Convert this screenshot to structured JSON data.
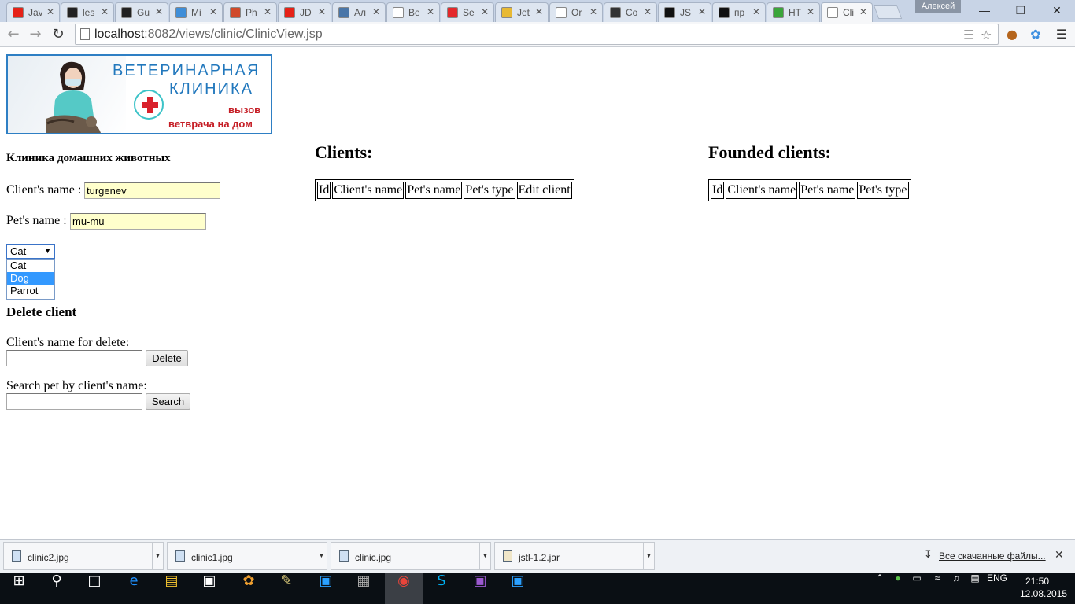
{
  "browser": {
    "tabs": [
      {
        "label": "Jav",
        "favicon_color": "#e62117"
      },
      {
        "label": "les",
        "favicon_color": "#222222"
      },
      {
        "label": "Gu",
        "favicon_color": "#222222"
      },
      {
        "label": "Mi",
        "favicon_color": "#3f8ed8"
      },
      {
        "label": "Ph",
        "favicon_color": "#d04a2a"
      },
      {
        "label": "JD",
        "favicon_color": "#e62117"
      },
      {
        "label": "Ал",
        "favicon_color": "#4a76a8"
      },
      {
        "label": "Be",
        "favicon_color": "#ffffff"
      },
      {
        "label": "Se",
        "favicon_color": "#e4282b"
      },
      {
        "label": "Jet",
        "favicon_color": "#e8b933"
      },
      {
        "label": "Or",
        "favicon_color": "#ffffff"
      },
      {
        "label": "Co",
        "favicon_color": "#333333"
      },
      {
        "label": "JS",
        "favicon_color": "#111111"
      },
      {
        "label": "пр",
        "favicon_color": "#111111"
      },
      {
        "label": "НТ",
        "favicon_color": "#3aa53a"
      },
      {
        "label": "Cli",
        "favicon_color": "#ffffff"
      }
    ],
    "user_name": "Алексей",
    "url_host": "localhost",
    "url_rest": ":8082/views/clinic/ClinicView.jsp"
  },
  "page": {
    "banner": {
      "line1": "ВЕТЕРИНАРНАЯ",
      "line2": "КЛИНИКА",
      "line3": "вызов",
      "line4": "ветврача на дом"
    },
    "clinic_title": "Клиника домашних животных",
    "client_name_label": "Client's name :",
    "client_name_value": "turgenev",
    "pet_name_label": "Pet's name :",
    "pet_name_value": "mu-mu",
    "pet_type_selected": "Cat",
    "pet_type_options": [
      "Cat",
      "Dog",
      "Parrot"
    ],
    "pet_type_highlighted": "Dog",
    "delete_title": "Delete client",
    "delete_label": "Client's name for delete:",
    "delete_button": "Delete",
    "search_label": "Search pet by client's name:",
    "search_button": "Search",
    "clients_title": "Clients:",
    "clients_headers": [
      "Id",
      "Client's name",
      "Pet's name",
      "Pet's type",
      "Edit client"
    ],
    "founded_title": "Founded clients:",
    "founded_headers": [
      "Id",
      "Client's name",
      "Pet's name",
      "Pet's type"
    ]
  },
  "downloads": {
    "items": [
      "clinic2.jpg",
      "clinic1.jpg",
      "clinic.jpg",
      "jstl-1.2.jar"
    ],
    "show_all": "Все скачанные файлы..."
  },
  "taskbar": {
    "language": "ENG",
    "time": "21:50",
    "date": "12.08.2015"
  }
}
